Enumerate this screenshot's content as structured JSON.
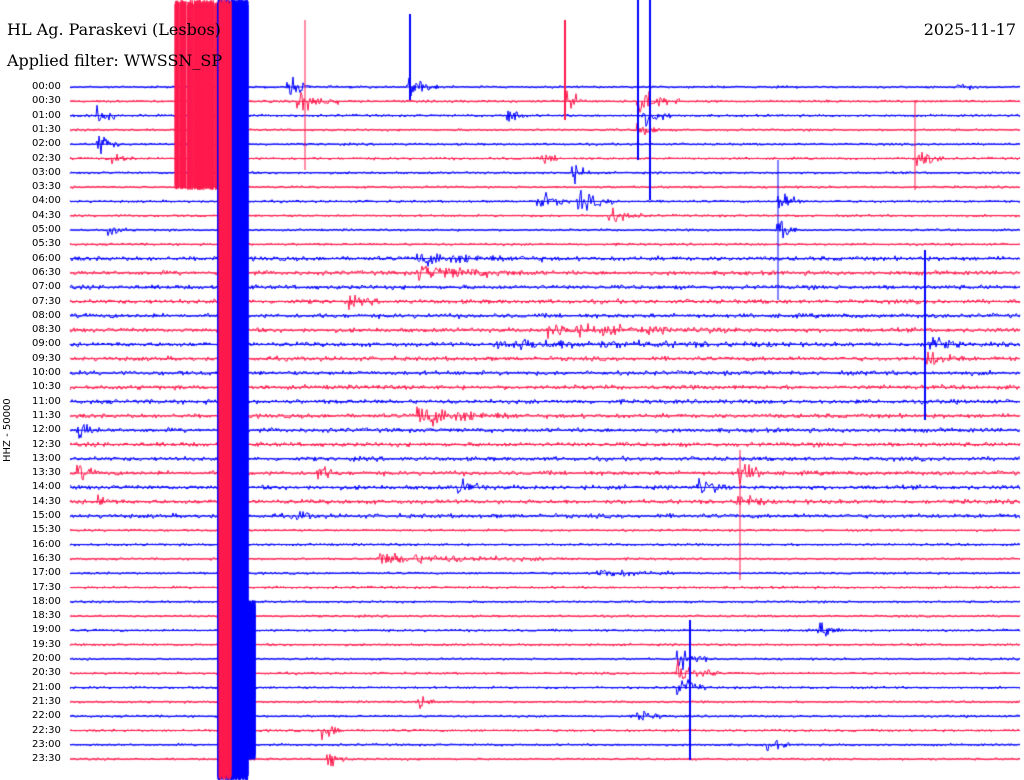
{
  "header": {
    "station": "HL Ag. Paraskevi (Lesbos)",
    "date": "2025-11-17",
    "filter": "Applied filter: WWSSN_SP"
  },
  "channel_label": "HHZ - 50000",
  "colors": {
    "trace_a": "#0000ff",
    "trace_b": "#ff1a4d",
    "text": "#000000",
    "background": "#ffffff"
  },
  "time_labels": [
    "00:00",
    "00:30",
    "01:00",
    "01:30",
    "02:00",
    "02:30",
    "03:00",
    "03:30",
    "04:00",
    "04:30",
    "05:00",
    "05:30",
    "06:00",
    "06:30",
    "07:00",
    "07:30",
    "08:00",
    "08:30",
    "09:00",
    "09:30",
    "10:00",
    "10:30",
    "11:00",
    "11:30",
    "12:00",
    "12:30",
    "13:00",
    "13:30",
    "14:00",
    "14:30",
    "15:00",
    "15:30",
    "16:00",
    "16:30",
    "17:00",
    "17:30",
    "18:00",
    "18:30",
    "19:00",
    "19:30",
    "20:00",
    "20:30",
    "21:00",
    "21:30",
    "22:00",
    "22:30",
    "23:00",
    "23:30"
  ]
}
